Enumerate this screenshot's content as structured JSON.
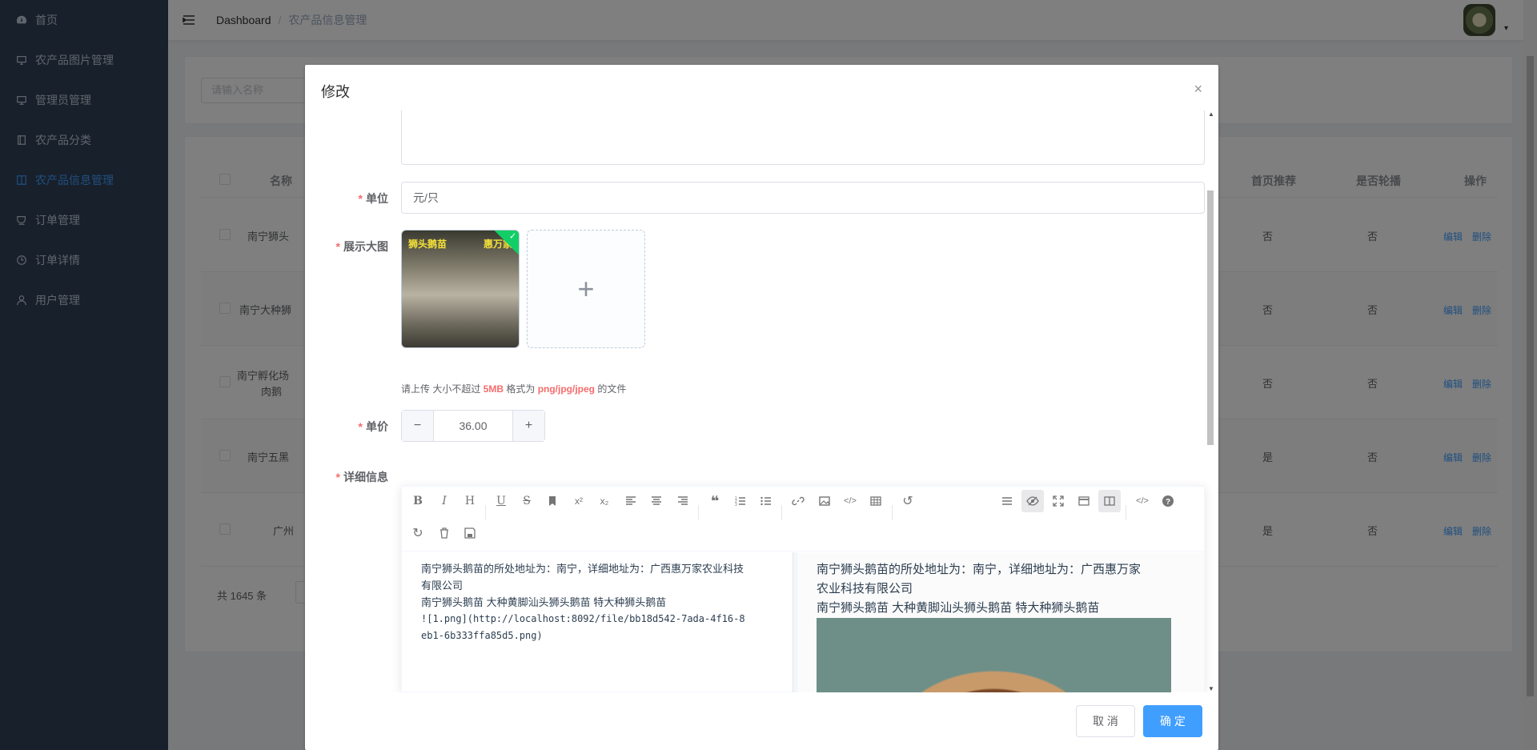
{
  "sidebar": {
    "items": [
      {
        "label": "首页",
        "icon": "dashboard-icon"
      },
      {
        "label": "农产品图片管理",
        "icon": "monitor-icon"
      },
      {
        "label": "管理员管理",
        "icon": "monitor-icon"
      },
      {
        "label": "农产品分类",
        "icon": "notebook-icon"
      },
      {
        "label": "农产品信息管理",
        "icon": "notebook-icon",
        "active": true
      },
      {
        "label": "订单管理",
        "icon": "cup-icon"
      },
      {
        "label": "订单详情",
        "icon": "clock-icon"
      },
      {
        "label": "用户管理",
        "icon": "user-icon"
      }
    ]
  },
  "breadcrumb": {
    "root": "Dashboard",
    "sep": "/",
    "current": "农产品信息管理"
  },
  "search": {
    "placeholder": "请输入名称"
  },
  "table": {
    "headers": {
      "name": "名称",
      "recommend": "首页推荐",
      "carousel": "是否轮播",
      "ops": "操作"
    },
    "rows": [
      {
        "name": "南宁狮头",
        "recommend": "否",
        "carousel": "否",
        "edit": "编辑",
        "delete": "删除"
      },
      {
        "name": "南宁大种狮",
        "recommend": "否",
        "carousel": "否",
        "edit": "编辑",
        "delete": "删除"
      },
      {
        "name_line1": "南宁孵化场",
        "name_line2": "肉鹅",
        "recommend": "否",
        "carousel": "否",
        "edit": "编辑",
        "delete": "删除"
      },
      {
        "name": "南宁五黑",
        "recommend": "是",
        "carousel": "否",
        "edit": "编辑",
        "delete": "删除"
      },
      {
        "name": "广州",
        "recommend": "是",
        "carousel": "否",
        "edit": "编辑",
        "delete": "删除"
      }
    ],
    "total": "共 1645 条"
  },
  "dialog": {
    "title": "修改",
    "close": "×",
    "unit": {
      "label": "单位",
      "value": "元/只"
    },
    "image": {
      "label": "展示大图",
      "thumb_text_left": "狮头鹅苗",
      "thumb_text_right": "惠万家",
      "check": "✓",
      "plus": "+"
    },
    "tip": {
      "prefix": "请上传 大小不超过 ",
      "size": "5MB",
      "mid": " 格式为 ",
      "formats": "png/jpg/jpeg",
      "suffix": " 的文件"
    },
    "price": {
      "label": "单价",
      "value": "36.00",
      "minus": "−",
      "plus": "+"
    },
    "detail": {
      "label": "详细信息",
      "source_line1": "南宁狮头鹅苗的所处地址为：南宁，详细地址为：广西惠万家农业科技",
      "source_line2": "有限公司",
      "source_line3": "南宁狮头鹅苗  大种黄脚汕头狮头鹅苗   特大种狮头鹅苗",
      "source_line4": "![1.png](http://localhost:8092/file/bb18d542-7ada-4f16-8",
      "source_line5": "eb1-6b333ffa85d5.png)",
      "preview_line1": "南宁狮头鹅苗的所处地址为：南宁，详细地址为：广西惠万家",
      "preview_line2": "农业科技有限公司",
      "preview_line3": "南宁狮头鹅苗 大种黄脚汕头狮头鹅苗 特大种狮头鹅苗"
    },
    "cancel": "取 消",
    "confirm": "确 定"
  },
  "colors": {
    "primary": "#409EFF",
    "danger": "#F56C6C",
    "sidebar": "#304156",
    "success": "#13ce66"
  }
}
